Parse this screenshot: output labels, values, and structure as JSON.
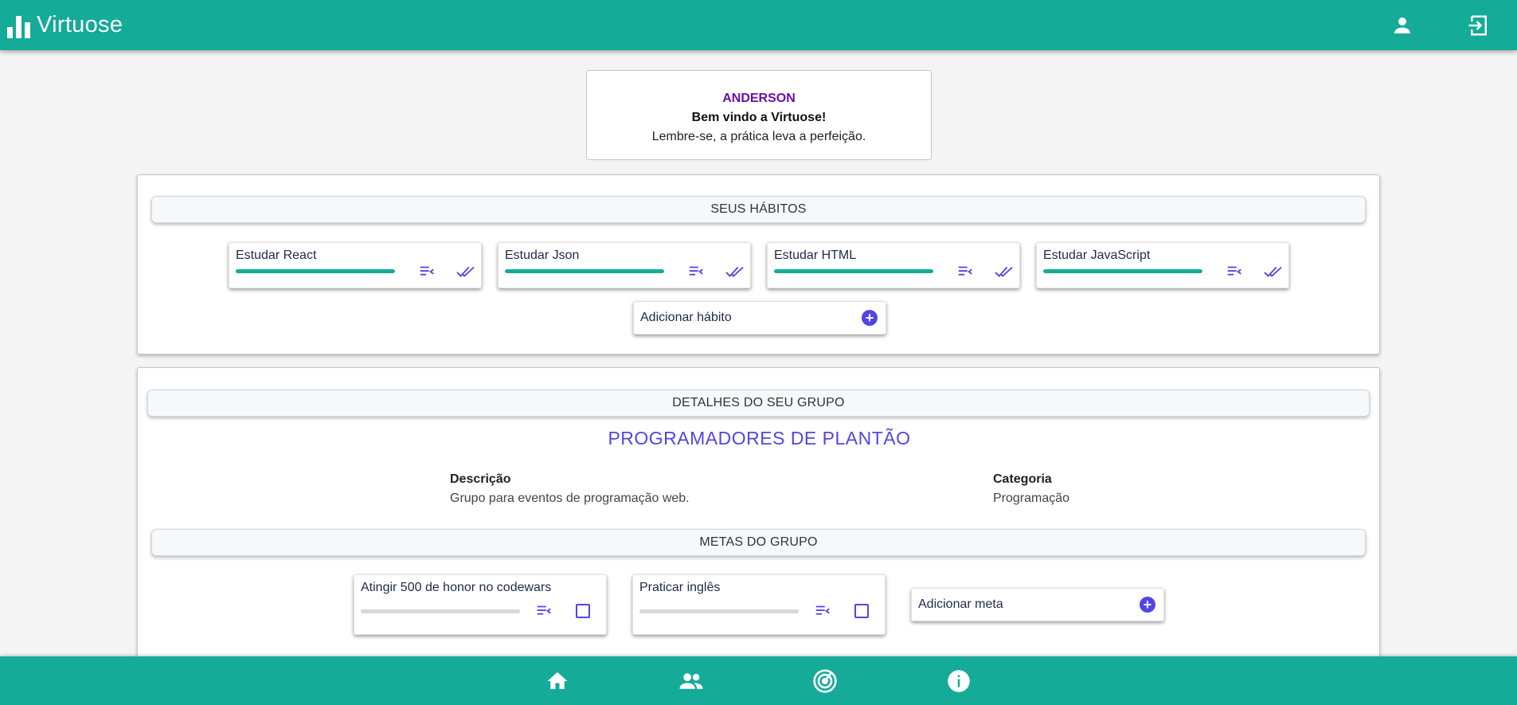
{
  "header": {
    "app_name": "Virtuose",
    "logo_icon": "bar-chart-icon",
    "profile_icon": "person-icon",
    "logout_icon": "logout-icon"
  },
  "welcome": {
    "user_name": "ANDERSON",
    "greeting": "Bem vindo a Virtuose!",
    "message": "Lembre-se, a prática leva a perfeição."
  },
  "habits": {
    "title": "SEUS HÁBITOS",
    "items": [
      {
        "label": "Estudar React",
        "progress_percent": 100
      },
      {
        "label": "Estudar Json",
        "progress_percent": 100
      },
      {
        "label": "Estudar HTML",
        "progress_percent": 100
      },
      {
        "label": "Estudar JavaScript",
        "progress_percent": 100
      }
    ],
    "add_label": "Adicionar hábito"
  },
  "group": {
    "title": "DETALHES DO SEU GRUPO",
    "name": "PROGRAMADORES DE PLANTÃO",
    "description_label": "Descrição",
    "description": "Grupo para eventos de programação web.",
    "category_label": "Categoria",
    "category": "Programação",
    "goals_title": "METAS DO GRUPO",
    "goals": [
      {
        "label": "Atingir 500 de honor no codewars",
        "progress_percent": 0
      },
      {
        "label": "Praticar inglês",
        "progress_percent": 0
      }
    ],
    "add_goal_label": "Adicionar meta"
  },
  "colors": {
    "primary": "#14ab98",
    "accent": "#5046e5",
    "user_name": "#6a0dad"
  },
  "footer_nav": [
    "home-icon",
    "group-icon",
    "target-icon",
    "info-icon"
  ]
}
